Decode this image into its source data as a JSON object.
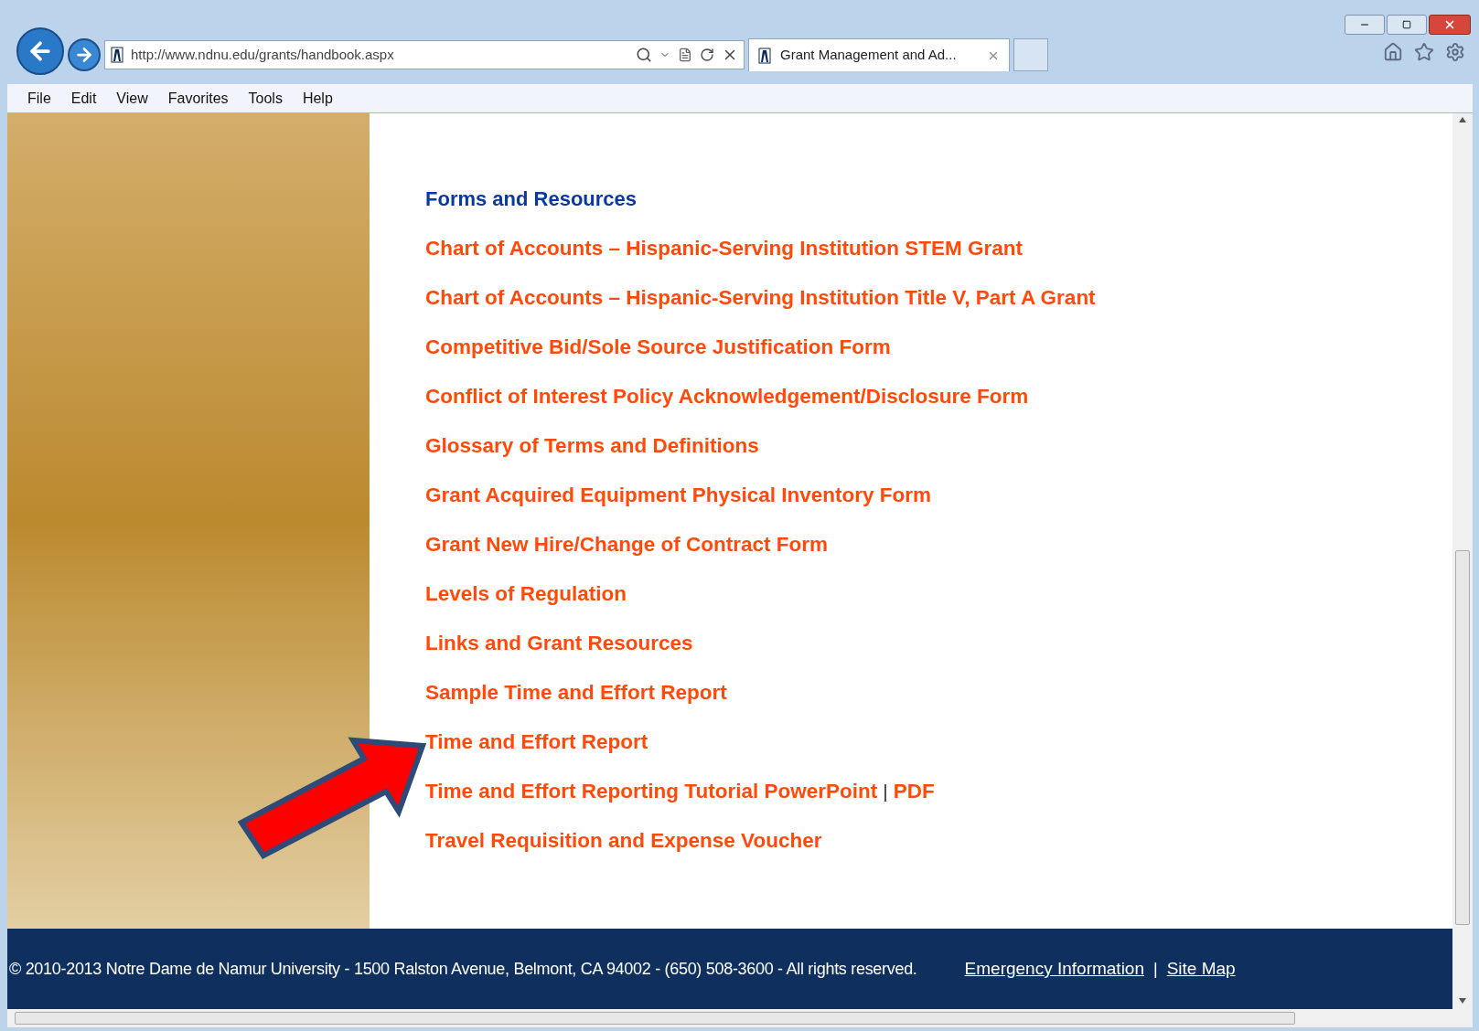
{
  "browser": {
    "address": "http://www.ndnu.edu/grants/handbook.aspx",
    "tab_title": "Grant Management and Ad...",
    "menu": [
      "File",
      "Edit",
      "View",
      "Favorites",
      "Tools",
      "Help"
    ]
  },
  "content": {
    "heading": "Forms and Resources",
    "links": [
      {
        "label": "Chart of Accounts – Hispanic-Serving Institution STEM Grant"
      },
      {
        "label": "Chart of Accounts – Hispanic-Serving Institution Title V, Part A Grant"
      },
      {
        "label": "Competitive Bid/Sole Source Justification Form"
      },
      {
        "label": "Conflict of Interest Policy Acknowledgement/Disclosure Form"
      },
      {
        "label": "Glossary of Terms and Definitions"
      },
      {
        "label": "Grant Acquired Equipment Physical Inventory Form"
      },
      {
        "label": "Grant New Hire/Change of Contract Form"
      },
      {
        "label": "Levels of Regulation"
      },
      {
        "label": "Links and Grant Resources"
      },
      {
        "label": "Sample Time and Effort Report"
      },
      {
        "label": "Time and Effort Report"
      },
      {
        "label": "Time and Effort Reporting Tutorial PowerPoint",
        "separator": "|",
        "extra": "PDF"
      },
      {
        "label": "Travel Requisition and Expense Voucher"
      }
    ]
  },
  "footer": {
    "copyright": "© 2010-2013 Notre Dame de Namur University - 1500 Ralston Avenue, Belmont, CA 94002 - (650) 508-3600 - All rights reserved.",
    "links": [
      "Emergency Information",
      "Site Map"
    ],
    "separator": "|"
  }
}
